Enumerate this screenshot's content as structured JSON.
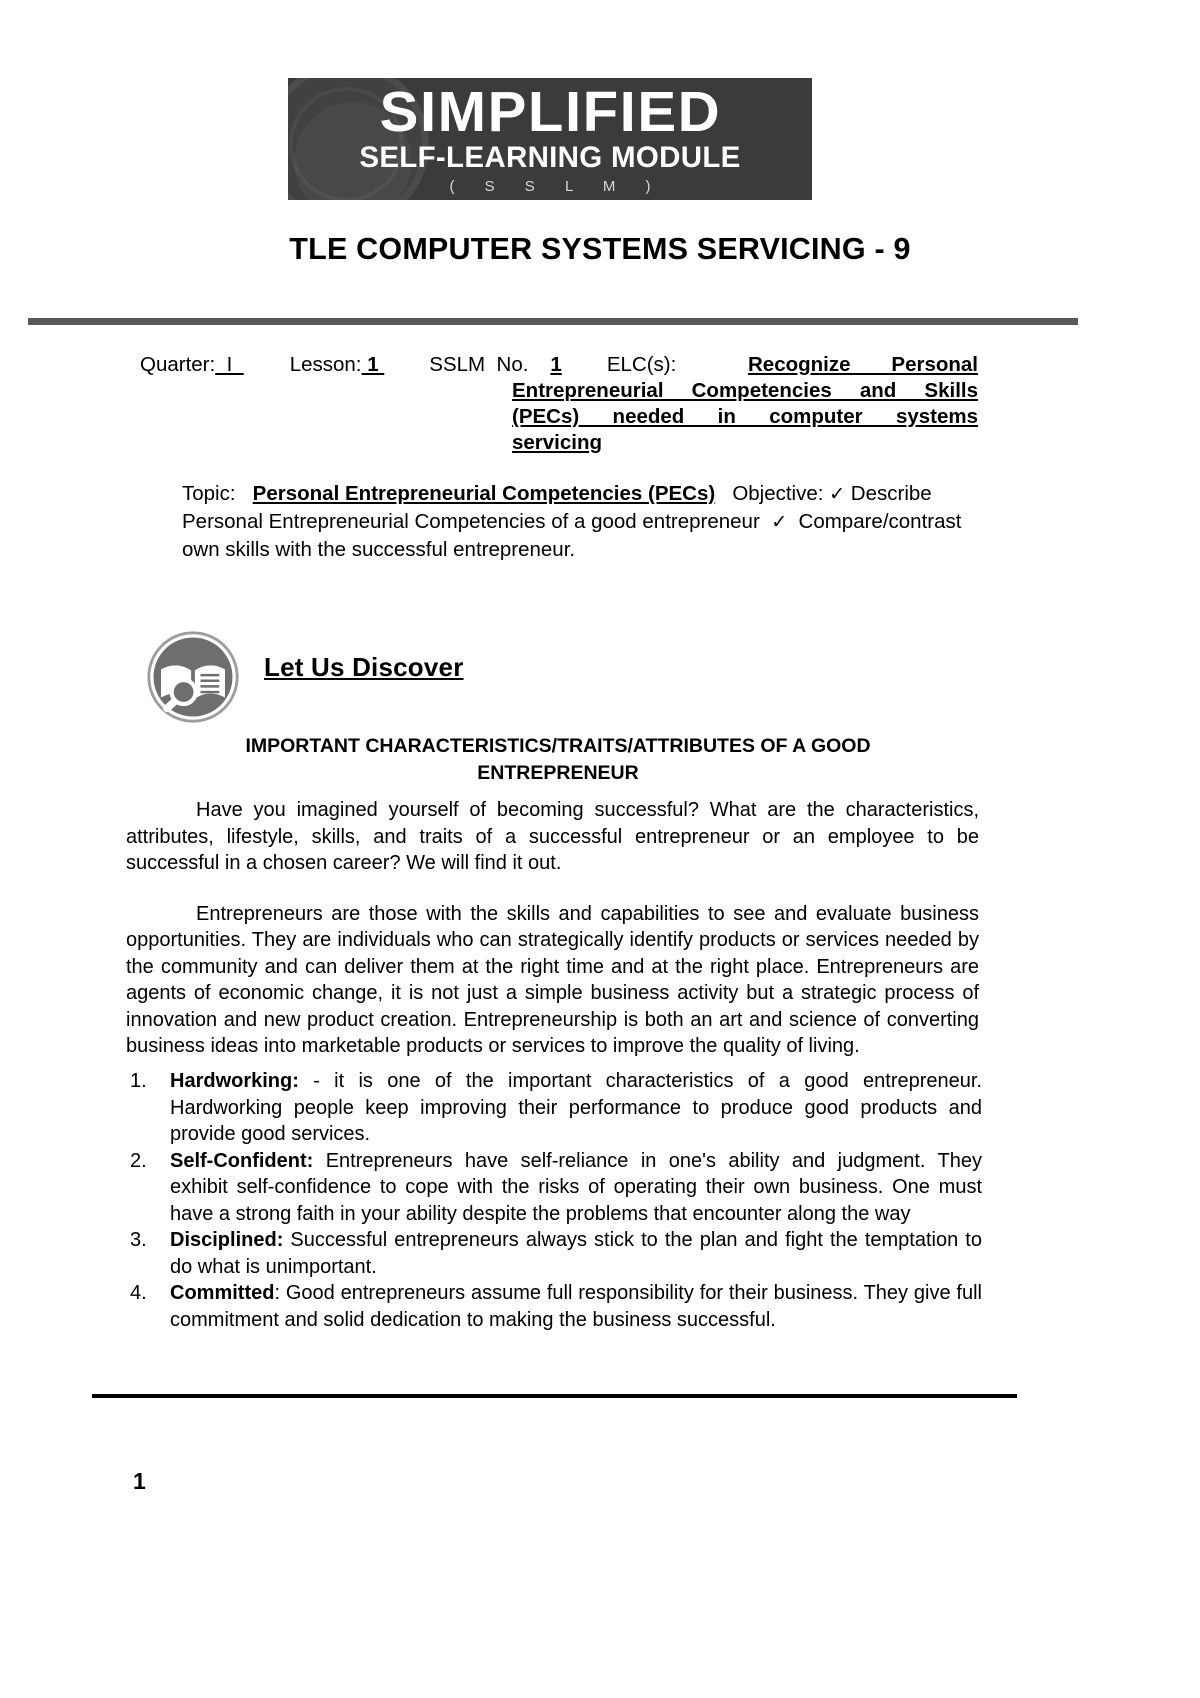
{
  "banner": {
    "line1": "SIMPLIFIED",
    "line2": "SELF-LEARNING MODULE",
    "line3": "( S S L M )",
    "bg_color": "#3b3b3b"
  },
  "document": {
    "title": "TLE COMPUTER SYSTEMS SERVICING - 9",
    "rule_color": "#595959"
  },
  "meta": {
    "quarter_label": "Quarter:",
    "quarter_value": "  I  ",
    "lesson_label": "Lesson:",
    "lesson_value": " 1 ",
    "sslm_label": "SSLM  No.",
    "sslm_value": "1",
    "elc_label": "ELC(s):",
    "elc_lines": [
      "Recognize Personal",
      "Entrepreneurial Competencies and Skills",
      "(PECs) needed in computer systems",
      "servicing"
    ]
  },
  "topic": {
    "topic_label": "Topic:",
    "topic_value": "Personal Entrepreneurial Competencies (PECs)",
    "objective_label": "Objective:",
    "check_glyph": "✓",
    "objective_1": "Describe Personal Entrepreneurial Competencies of a good entrepreneur",
    "objective_2": "Compare/contrast own skills with the successful entrepreneur."
  },
  "discover": {
    "icon_name": "book-magnifier-icon",
    "title": "Let Us Discover",
    "heading_line1": "IMPORTANT CHARACTERISTICS/TRAITS/ATTRIBUTES OF A GOOD",
    "heading_line2": "ENTREPRENEUR"
  },
  "paragraphs": [
    "Have you imagined yourself of becoming successful? What are the characteristics, attributes, lifestyle, skills, and traits of a successful entrepreneur or an employee to be successful in a chosen career? We will find it out.",
    "Entrepreneurs are those with the skills and capabilities to see and evaluate business opportunities. They are individuals who can strategically identify products or services needed by the community and can deliver them at the right time and at the right place.  Entrepreneurs are agents of economic change, it is not just a simple business activity but a strategic process of innovation and new product creation. Entrepreneurship is both an art and science of converting business ideas into marketable products or services to improve the quality of living."
  ],
  "traits": [
    {
      "number": "1.",
      "term": "Hardworking:",
      "text": " - it is one of the important characteristics of a good entrepreneur. Hardworking people keep improving their performance to produce good products and provide good services."
    },
    {
      "number": "2.",
      "term": "Self-Confident:",
      "text": " Entrepreneurs have self-reliance in one's ability and judgment. They exhibit self-confidence to cope with the risks of operating their own business. One must have a strong faith in your ability despite the problems that encounter along the way"
    },
    {
      "number": "3.",
      "term": "Disciplined:",
      "text": " Successful entrepreneurs always stick to the plan and fight the temptation to do what is unimportant."
    },
    {
      "number": "4.",
      "term": "Committed",
      "text": ": Good entrepreneurs assume full responsibility for their business. They give full commitment and solid dedication to making the business successful."
    }
  ],
  "footer": {
    "page_number": "1"
  }
}
